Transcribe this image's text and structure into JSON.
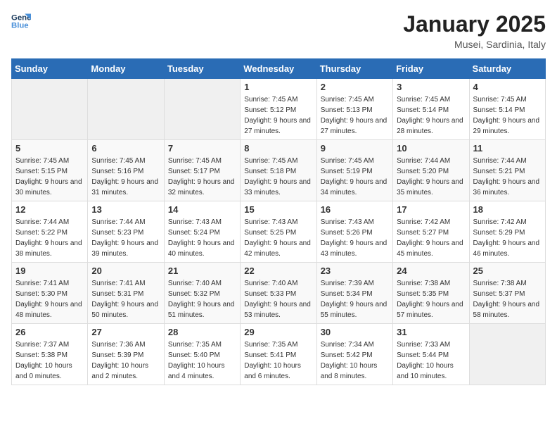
{
  "logo": {
    "line1": "General",
    "line2": "Blue"
  },
  "title": "January 2025",
  "subtitle": "Musei, Sardinia, Italy",
  "days_header": [
    "Sunday",
    "Monday",
    "Tuesday",
    "Wednesday",
    "Thursday",
    "Friday",
    "Saturday"
  ],
  "weeks": [
    [
      {
        "day": "",
        "info": ""
      },
      {
        "day": "",
        "info": ""
      },
      {
        "day": "",
        "info": ""
      },
      {
        "day": "1",
        "info": "Sunrise: 7:45 AM\nSunset: 5:12 PM\nDaylight: 9 hours and 27 minutes."
      },
      {
        "day": "2",
        "info": "Sunrise: 7:45 AM\nSunset: 5:13 PM\nDaylight: 9 hours and 27 minutes."
      },
      {
        "day": "3",
        "info": "Sunrise: 7:45 AM\nSunset: 5:14 PM\nDaylight: 9 hours and 28 minutes."
      },
      {
        "day": "4",
        "info": "Sunrise: 7:45 AM\nSunset: 5:14 PM\nDaylight: 9 hours and 29 minutes."
      }
    ],
    [
      {
        "day": "5",
        "info": "Sunrise: 7:45 AM\nSunset: 5:15 PM\nDaylight: 9 hours and 30 minutes."
      },
      {
        "day": "6",
        "info": "Sunrise: 7:45 AM\nSunset: 5:16 PM\nDaylight: 9 hours and 31 minutes."
      },
      {
        "day": "7",
        "info": "Sunrise: 7:45 AM\nSunset: 5:17 PM\nDaylight: 9 hours and 32 minutes."
      },
      {
        "day": "8",
        "info": "Sunrise: 7:45 AM\nSunset: 5:18 PM\nDaylight: 9 hours and 33 minutes."
      },
      {
        "day": "9",
        "info": "Sunrise: 7:45 AM\nSunset: 5:19 PM\nDaylight: 9 hours and 34 minutes."
      },
      {
        "day": "10",
        "info": "Sunrise: 7:44 AM\nSunset: 5:20 PM\nDaylight: 9 hours and 35 minutes."
      },
      {
        "day": "11",
        "info": "Sunrise: 7:44 AM\nSunset: 5:21 PM\nDaylight: 9 hours and 36 minutes."
      }
    ],
    [
      {
        "day": "12",
        "info": "Sunrise: 7:44 AM\nSunset: 5:22 PM\nDaylight: 9 hours and 38 minutes."
      },
      {
        "day": "13",
        "info": "Sunrise: 7:44 AM\nSunset: 5:23 PM\nDaylight: 9 hours and 39 minutes."
      },
      {
        "day": "14",
        "info": "Sunrise: 7:43 AM\nSunset: 5:24 PM\nDaylight: 9 hours and 40 minutes."
      },
      {
        "day": "15",
        "info": "Sunrise: 7:43 AM\nSunset: 5:25 PM\nDaylight: 9 hours and 42 minutes."
      },
      {
        "day": "16",
        "info": "Sunrise: 7:43 AM\nSunset: 5:26 PM\nDaylight: 9 hours and 43 minutes."
      },
      {
        "day": "17",
        "info": "Sunrise: 7:42 AM\nSunset: 5:27 PM\nDaylight: 9 hours and 45 minutes."
      },
      {
        "day": "18",
        "info": "Sunrise: 7:42 AM\nSunset: 5:29 PM\nDaylight: 9 hours and 46 minutes."
      }
    ],
    [
      {
        "day": "19",
        "info": "Sunrise: 7:41 AM\nSunset: 5:30 PM\nDaylight: 9 hours and 48 minutes."
      },
      {
        "day": "20",
        "info": "Sunrise: 7:41 AM\nSunset: 5:31 PM\nDaylight: 9 hours and 50 minutes."
      },
      {
        "day": "21",
        "info": "Sunrise: 7:40 AM\nSunset: 5:32 PM\nDaylight: 9 hours and 51 minutes."
      },
      {
        "day": "22",
        "info": "Sunrise: 7:40 AM\nSunset: 5:33 PM\nDaylight: 9 hours and 53 minutes."
      },
      {
        "day": "23",
        "info": "Sunrise: 7:39 AM\nSunset: 5:34 PM\nDaylight: 9 hours and 55 minutes."
      },
      {
        "day": "24",
        "info": "Sunrise: 7:38 AM\nSunset: 5:35 PM\nDaylight: 9 hours and 57 minutes."
      },
      {
        "day": "25",
        "info": "Sunrise: 7:38 AM\nSunset: 5:37 PM\nDaylight: 9 hours and 58 minutes."
      }
    ],
    [
      {
        "day": "26",
        "info": "Sunrise: 7:37 AM\nSunset: 5:38 PM\nDaylight: 10 hours and 0 minutes."
      },
      {
        "day": "27",
        "info": "Sunrise: 7:36 AM\nSunset: 5:39 PM\nDaylight: 10 hours and 2 minutes."
      },
      {
        "day": "28",
        "info": "Sunrise: 7:35 AM\nSunset: 5:40 PM\nDaylight: 10 hours and 4 minutes."
      },
      {
        "day": "29",
        "info": "Sunrise: 7:35 AM\nSunset: 5:41 PM\nDaylight: 10 hours and 6 minutes."
      },
      {
        "day": "30",
        "info": "Sunrise: 7:34 AM\nSunset: 5:42 PM\nDaylight: 10 hours and 8 minutes."
      },
      {
        "day": "31",
        "info": "Sunrise: 7:33 AM\nSunset: 5:44 PM\nDaylight: 10 hours and 10 minutes."
      },
      {
        "day": "",
        "info": ""
      }
    ]
  ]
}
